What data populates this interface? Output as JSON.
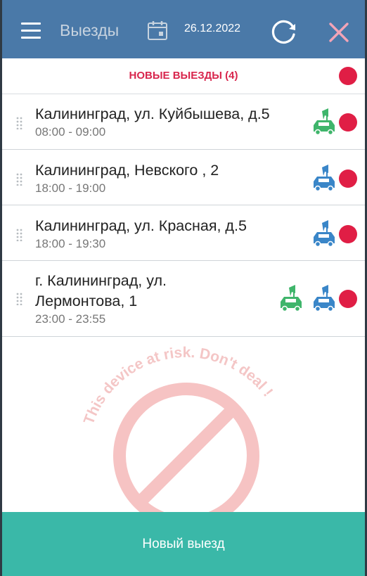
{
  "header": {
    "title": "Выезды",
    "date": "26.12.2022"
  },
  "section": {
    "title": "НОВЫЕ ВЫЕЗДЫ (4)"
  },
  "trips": [
    {
      "address": "Калининград, ул. Куйбышева, д.5",
      "time": "08:00 - 09:00",
      "icons": [
        "green-car-flag-icon"
      ]
    },
    {
      "address": "Калининград, Невского , 2",
      "time": "18:00 - 19:00",
      "icons": [
        "blue-car-flag-icon"
      ]
    },
    {
      "address": "Калининград, ул. Красная, д.5",
      "time": "18:00 - 19:30",
      "icons": [
        "blue-car-flag-icon"
      ]
    },
    {
      "address_line1": "г. Калининград, ул.",
      "address_line2": "Лермонтова, 1",
      "time": "23:00 - 23:55",
      "icons": [
        "green-car-flag-icon",
        "blue-car-flag-icon"
      ]
    }
  ],
  "watermark": {
    "text": "This device at risk. Don't deal !"
  },
  "footer": {
    "new_trip_label": "Новый выезд"
  },
  "colors": {
    "header_bg": "#4a79a8",
    "accent_red": "#e01e45",
    "footer_bg": "#3ab8a8",
    "car_green": "#3fb56b",
    "car_blue": "#3a86c8"
  }
}
